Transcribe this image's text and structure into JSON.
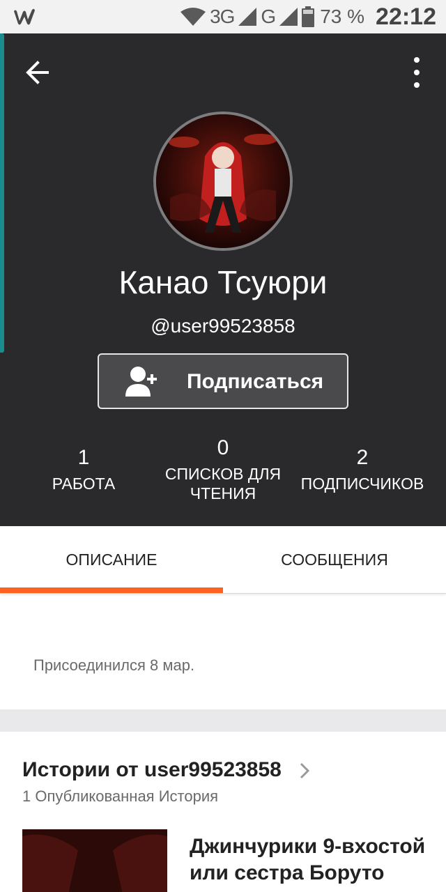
{
  "status_bar": {
    "network_3g": "3G",
    "network_g": "G",
    "battery": "73 %",
    "time": "22:12"
  },
  "profile": {
    "display_name": "Канао Тсуюри",
    "username": "@user99523858",
    "follow_label": "Подписаться",
    "stats": {
      "works": {
        "value": "1",
        "label": "РАБОТА"
      },
      "reading_lists": {
        "value": "0",
        "label_line1": "СПИСКОВ ДЛЯ",
        "label_line2": "ЧТЕНИЯ"
      },
      "followers": {
        "value": "2",
        "label": "ПОДПИСЧИКОВ"
      }
    }
  },
  "tabs": [
    {
      "label": "ОПИСАНИЕ",
      "active": true
    },
    {
      "label": "СООБЩЕНИЯ",
      "active": false
    }
  ],
  "about": {
    "joined": "Присоединился 8 мар."
  },
  "stories": {
    "title": "Истории от user99523858",
    "count_text": "1 Опубликованная История",
    "items": [
      {
        "title": "Джинчурики 9-вхостой или сестра Боруто"
      }
    ]
  },
  "colors": {
    "header_bg": "#2a2a2c",
    "accent_orange": "#ff6122",
    "accent_teal": "#1a8e8e"
  }
}
